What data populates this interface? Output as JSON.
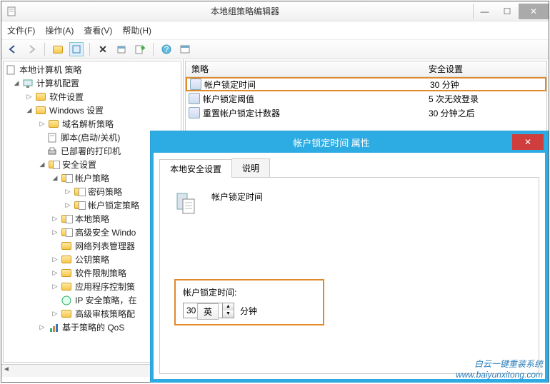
{
  "window": {
    "title": "本地组策略编辑器",
    "menu": {
      "file": "文件(F)",
      "action": "操作(A)",
      "view": "查看(V)",
      "help": "帮助(H)"
    }
  },
  "tree": {
    "root": "本地计算机 策略",
    "computer_config": "计算机配置",
    "software_settings": "软件设置",
    "windows_settings": "Windows 设置",
    "name_resolution": "域名解析策略",
    "scripts": "脚本(启动/关机)",
    "deployed_printers": "已部署的打印机",
    "security_settings": "安全设置",
    "account_policies": "帐户策略",
    "password_policy": "密码策略",
    "account_lockout_policy": "帐户锁定策略",
    "local_policies": "本地策略",
    "advanced_windows": "高级安全 Windo",
    "network_list": "网络列表管理器",
    "public_key": "公钥策略",
    "software_restriction": "软件限制策略",
    "app_control": "应用程序控制策",
    "ip_security": "IP 安全策略，在",
    "advanced_audit": "高级审核策略配",
    "qos": "基于策略的 QoS"
  },
  "list": {
    "header_policy": "策略",
    "header_setting": "安全设置",
    "rows": [
      {
        "name": "帐户锁定时间",
        "value": "30 分钟"
      },
      {
        "name": "帐户锁定阈值",
        "value": "5 次无效登录"
      },
      {
        "name": "重置帐户锁定计数器",
        "value": "30 分钟之后"
      }
    ]
  },
  "dialog": {
    "title": "帐户锁定时间 属性",
    "tab_local": "本地安全设置",
    "tab_explain": "说明",
    "prop_name": "帐户锁定时间",
    "field_label": "帐户锁定时间:",
    "field_value": "30",
    "field_unit": "分钟",
    "ime_hint": "英"
  },
  "watermark": {
    "line1": "白云一键重装系统",
    "line2": "www.baiyunxitong.com"
  }
}
